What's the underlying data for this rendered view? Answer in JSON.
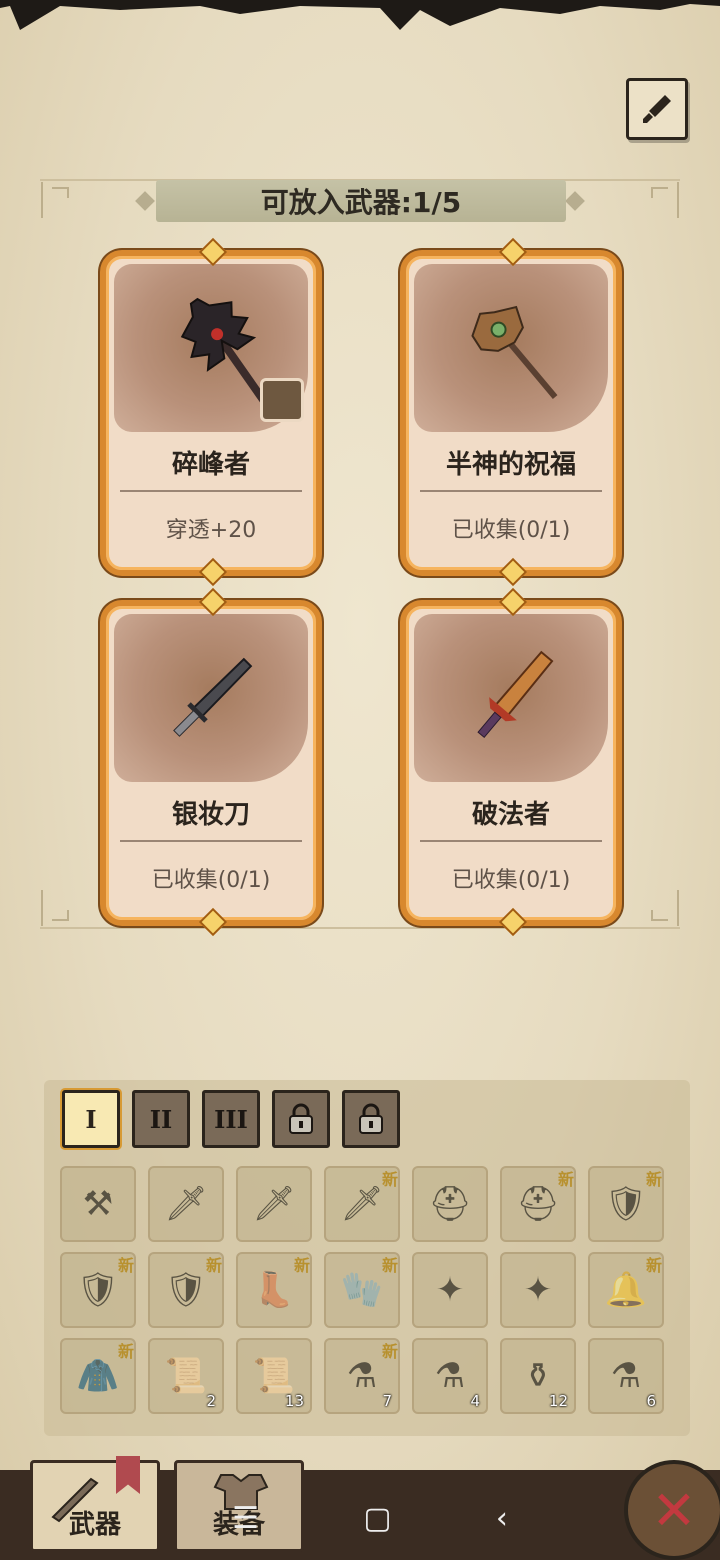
{
  "header": {
    "capacity_label": "可放入武器:1/5"
  },
  "colors": {
    "card_border": "#d8882e",
    "card_face": "#f1dcc7",
    "accent_red": "#c2393f",
    "paper": "#e9dfc6"
  },
  "cards": [
    {
      "name": "碎峰者",
      "stat": "穿透+20",
      "icon": "dark-spiked-axe-icon",
      "has_slot": true
    },
    {
      "name": "半神的祝福",
      "stat": "已收集(0/1)",
      "icon": "leaf-axe-icon",
      "has_slot": false
    },
    {
      "name": "银妆刀",
      "stat": "已收集(0/1)",
      "icon": "silver-dagger-icon",
      "has_slot": false
    },
    {
      "name": "破法者",
      "stat": "已收集(0/1)",
      "icon": "flame-sword-icon",
      "has_slot": false
    }
  ],
  "tiers": [
    {
      "label": "I",
      "active": true,
      "locked": false
    },
    {
      "label": "II",
      "active": false,
      "locked": false
    },
    {
      "label": "III",
      "active": false,
      "locked": false
    },
    {
      "label": "",
      "active": false,
      "locked": true
    },
    {
      "label": "",
      "active": false,
      "locked": true
    }
  ],
  "inventory": {
    "new_badge": "新",
    "rows": [
      [
        {
          "icon": "leaf-axe-icon",
          "glyph": "⚒",
          "new": false,
          "count": ""
        },
        {
          "icon": "bone-sword-icon",
          "glyph": "🗡",
          "new": false,
          "count": ""
        },
        {
          "icon": "curved-blade-icon",
          "glyph": "🗡",
          "new": false,
          "count": ""
        },
        {
          "icon": "red-blade-icon",
          "glyph": "🗡",
          "new": true,
          "count": ""
        },
        {
          "icon": "horned-helmet-icon",
          "glyph": "⛑",
          "new": false,
          "count": ""
        },
        {
          "icon": "straw-hat-icon",
          "glyph": "⛑",
          "new": true,
          "count": ""
        },
        {
          "icon": "shoulder-armor-icon",
          "glyph": "🛡",
          "new": true,
          "count": ""
        }
      ],
      [
        {
          "icon": "shoulder-armor-icon",
          "glyph": "🛡",
          "new": true,
          "count": ""
        },
        {
          "icon": "shoulder-armor-icon",
          "glyph": "🛡",
          "new": true,
          "count": ""
        },
        {
          "icon": "boots-icon",
          "glyph": "👢",
          "new": true,
          "count": ""
        },
        {
          "icon": "gauntlet-icon",
          "glyph": "🧤",
          "new": true,
          "count": ""
        },
        {
          "icon": "ornate-emblem-icon",
          "glyph": "✦",
          "new": false,
          "count": ""
        },
        {
          "icon": "dragon-emblem-icon",
          "glyph": "✦",
          "new": false,
          "count": ""
        },
        {
          "icon": "bell-icon",
          "glyph": "🔔",
          "new": true,
          "count": ""
        }
      ],
      [
        {
          "icon": "coat-icon",
          "glyph": "🧥",
          "new": true,
          "count": ""
        },
        {
          "icon": "scroll-icon",
          "glyph": "📜",
          "new": false,
          "count": "2"
        },
        {
          "icon": "eye-scroll-icon",
          "glyph": "📜",
          "new": false,
          "count": "13"
        },
        {
          "icon": "red-potion-icon",
          "glyph": "⚗",
          "new": true,
          "count": "7"
        },
        {
          "icon": "horn-potion-icon",
          "glyph": "⚗",
          "new": false,
          "count": "4"
        },
        {
          "icon": "jar-icon",
          "glyph": "⚱",
          "new": false,
          "count": "12"
        },
        {
          "icon": "star-potion-icon",
          "glyph": "⚗",
          "new": false,
          "count": "6"
        }
      ]
    ]
  },
  "bottom_tabs": [
    {
      "label": "武器",
      "icon": "crossed-swords-icon",
      "active": true
    },
    {
      "label": "装备",
      "icon": "armor-icon",
      "active": false
    }
  ],
  "system_nav": {
    "menu": "☰",
    "home": "▢",
    "back": "‹"
  },
  "close_label": "✕"
}
